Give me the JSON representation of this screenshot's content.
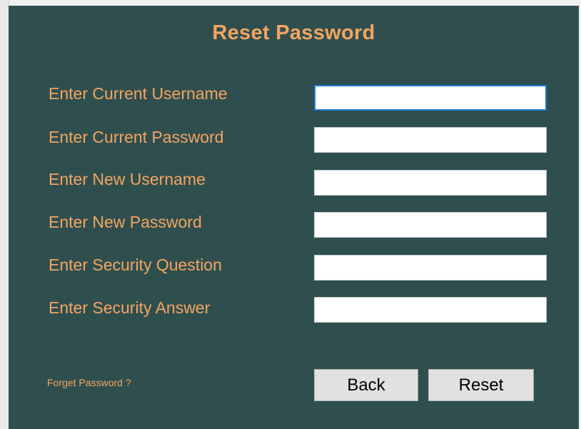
{
  "window": {
    "title": "Reset Password"
  },
  "form": {
    "fields": [
      {
        "label": "Enter Current Username",
        "value": "",
        "placeholder": ""
      },
      {
        "label": "Enter Current Password",
        "value": "",
        "placeholder": ""
      },
      {
        "label": "Enter New Username",
        "value": "",
        "placeholder": ""
      },
      {
        "label": "Enter New Password",
        "value": "",
        "placeholder": ""
      },
      {
        "label": "Enter Security Question",
        "value": "",
        "placeholder": ""
      },
      {
        "label": "Enter Security Answer",
        "value": "",
        "placeholder": ""
      }
    ]
  },
  "links": {
    "forget_password": "Forget Password  ?"
  },
  "buttons": {
    "back_label": "Back",
    "reset_label": "Reset"
  },
  "colors": {
    "panel_background": "#2f4f4f",
    "accent_text": "#f4a460",
    "focus_border": "#1e7ad6"
  }
}
